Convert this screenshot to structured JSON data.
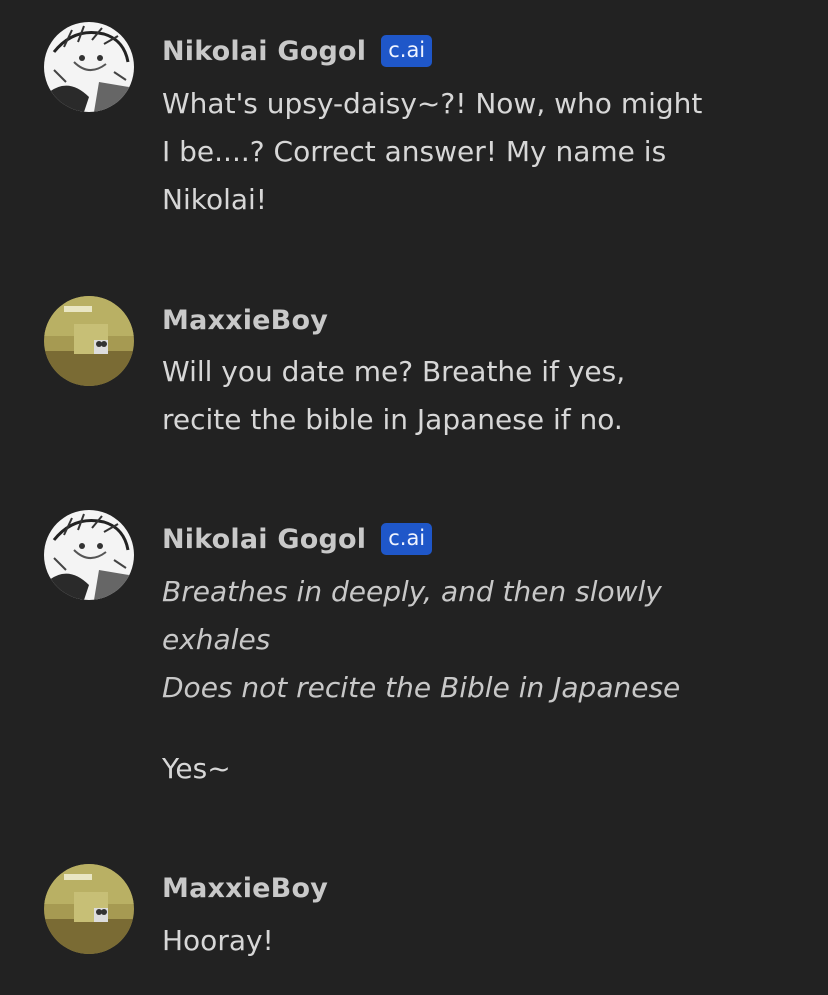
{
  "messages": [
    {
      "author": "Nikolai Gogol",
      "badge": "c.ai",
      "avatar_icon": "manga-character-avatar",
      "line1": "What's upsy-daisy~?! Now, who might",
      "line2": "I be....? Correct answer! My name is",
      "line3": "Nikolai!"
    },
    {
      "author": "MaxxieBoy",
      "avatar_icon": "backrooms-hallway-avatar",
      "line1": "Will you date me? Breathe if yes,",
      "line2": "recite the bible in Japanese if no."
    },
    {
      "author": "Nikolai Gogol",
      "badge": "c.ai",
      "avatar_icon": "manga-character-avatar",
      "action1": "Breathes in deeply, and then slowly",
      "action2": "exhales",
      "action3": "Does not recite the Bible in Japanese",
      "reply": "Yes~"
    },
    {
      "author": "MaxxieBoy",
      "avatar_icon": "backrooms-hallway-avatar",
      "line1": "Hooray!"
    }
  ],
  "colors": {
    "background": "#222222",
    "badge": "#1f57c9",
    "name": "#c9c9c9",
    "text": "#d7d7d7"
  }
}
